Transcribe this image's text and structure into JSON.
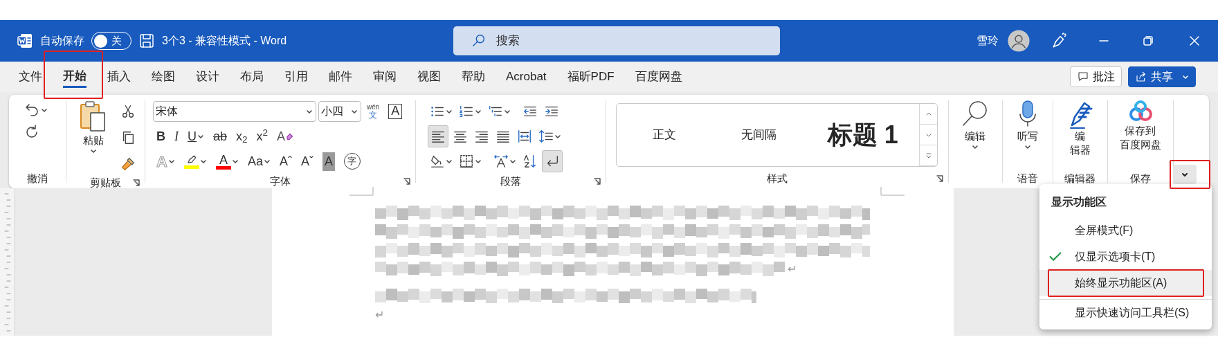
{
  "title_bar": {
    "autosave_label": "自动保存",
    "autosave": {
      "on": false,
      "label": "关"
    },
    "document_title": "3个3 - 兼容性模式 - Word",
    "search": {
      "placeholder": "搜索"
    },
    "user_name": "雪玲"
  },
  "tabs": [
    {
      "label": "文件",
      "selected": false,
      "framed": false
    },
    {
      "label": "开始",
      "selected": true,
      "framed": true
    },
    {
      "label": "插入",
      "selected": false,
      "framed": false
    },
    {
      "label": "绘图",
      "selected": false,
      "framed": false
    },
    {
      "label": "设计",
      "selected": false,
      "framed": false
    },
    {
      "label": "布局",
      "selected": false,
      "framed": false
    },
    {
      "label": "引用",
      "selected": false,
      "framed": false
    },
    {
      "label": "邮件",
      "selected": false,
      "framed": false
    },
    {
      "label": "审阅",
      "selected": false,
      "framed": false
    },
    {
      "label": "视图",
      "selected": false,
      "framed": false
    },
    {
      "label": "帮助",
      "selected": false,
      "framed": false
    },
    {
      "label": "Acrobat",
      "selected": false,
      "framed": false
    },
    {
      "label": "福昕PDF",
      "selected": false,
      "framed": false
    },
    {
      "label": "百度网盘",
      "selected": false,
      "framed": false
    }
  ],
  "comment_button": "批注",
  "share_button": "共享",
  "ribbon": {
    "undo": {
      "label": "撤消"
    },
    "clipboard": {
      "label": "剪贴板",
      "paste": "粘贴"
    },
    "font": {
      "label": "字体",
      "name": "宋体",
      "size": "小四",
      "top_row": [
        {
          "kind": "phonetic",
          "top": "wén",
          "label": "文",
          "dropdown": false
        },
        {
          "kind": "bordered",
          "label": "A",
          "dropdown": false
        }
      ],
      "middle_row": [
        {
          "kind": "bold",
          "label": "B",
          "dropdown": false
        },
        {
          "kind": "italic",
          "label": "I",
          "dropdown": false
        },
        {
          "kind": "underline",
          "label": "U",
          "dropdown": true
        },
        {
          "kind": "strike",
          "label": "ab",
          "dropdown": false
        },
        {
          "kind": "glyph",
          "label": "x$_{2}$",
          "dropdown": false
        },
        {
          "kind": "glyph",
          "label": "x$^{2}$",
          "dropdown": false
        },
        {
          "kind": "clear",
          "label": "A",
          "dropdown": false
        }
      ],
      "bottom_row": [
        {
          "kind": "outlined",
          "label": "A",
          "dropdown": true
        },
        {
          "kind": "highlight",
          "color": "#ffff00",
          "dropdown": true
        },
        {
          "kind": "fontcolor",
          "label": "A",
          "color": "#ff0000",
          "dropdown": true
        },
        {
          "kind": "glyph",
          "label": "Aa",
          "dropdown": true
        },
        {
          "kind": "glyph",
          "label": "Aˆ",
          "dropdown": false
        },
        {
          "kind": "glyph",
          "label": "Aˇ",
          "dropdown": false
        },
        {
          "kind": "shaded",
          "label": "A",
          "dropdown": false
        },
        {
          "kind": "circled",
          "label": "字",
          "dropdown": false
        }
      ]
    },
    "paragraph": {
      "label": "段落",
      "top_row": [
        {
          "kind": "bullets",
          "dropdown": true,
          "selected": false
        },
        {
          "kind": "numbering",
          "dropdown": true,
          "selected": false
        },
        {
          "kind": "multilevel",
          "dropdown": true,
          "selected": false
        },
        {
          "kind": "outdent",
          "dropdown": false,
          "selected": false
        },
        {
          "kind": "indent",
          "dropdown": false,
          "selected": false
        }
      ],
      "middle_row": [
        {
          "kind": "align-left",
          "dropdown": false,
          "selected": true
        },
        {
          "kind": "align-center",
          "dropdown": false,
          "selected": false
        },
        {
          "kind": "align-right",
          "dropdown": false,
          "selected": false
        },
        {
          "kind": "justify",
          "dropdown": false,
          "selected": false
        },
        {
          "kind": "distributed",
          "dropdown": false,
          "selected": false
        },
        {
          "kind": "line-spacing",
          "dropdown": true,
          "selected": false
        }
      ],
      "bottom_row": [
        {
          "kind": "shading",
          "dropdown": true,
          "selected": false
        },
        {
          "kind": "borders",
          "dropdown": true,
          "selected": false
        },
        {
          "kind": "asian-layout",
          "dropdown": true,
          "selected": false
        },
        {
          "kind": "sort",
          "dropdown": false,
          "selected": false
        },
        {
          "kind": "marks",
          "dropdown": false,
          "selected": true
        }
      ]
    },
    "styles": {
      "label": "样式",
      "items": [
        {
          "label": "正文",
          "kind": "normal"
        },
        {
          "label": "无间隔",
          "kind": "normal"
        },
        {
          "label": "标题 1",
          "kind": "heading"
        }
      ]
    },
    "editing": {
      "button": "编辑"
    },
    "voice": {
      "label": "语音",
      "button": "听写"
    },
    "editor": {
      "label": "编辑器",
      "button": [
        "编",
        "辑器"
      ]
    },
    "save": {
      "label": "保存",
      "button": [
        "保存到",
        "百度网盘"
      ]
    },
    "collapse_button": {
      "framed": true
    }
  },
  "document": {
    "empty_paragraph_mark": "↵",
    "line_end_mark": "↵"
  },
  "ribbon_menu": {
    "title": "显示功能区",
    "items": [
      {
        "label": "全屏模式(F)",
        "checked": false,
        "hovered": false,
        "framed": false,
        "separator_before": false
      },
      {
        "label": "仅显示选项卡(T)",
        "checked": true,
        "hovered": false,
        "framed": false,
        "separator_before": false
      },
      {
        "label": "始终显示功能区(A)",
        "checked": false,
        "hovered": true,
        "framed": true,
        "separator_before": false
      },
      {
        "label": "显示快速访问工具栏(S)",
        "checked": false,
        "hovered": false,
        "framed": false,
        "separator_before": true
      }
    ]
  }
}
